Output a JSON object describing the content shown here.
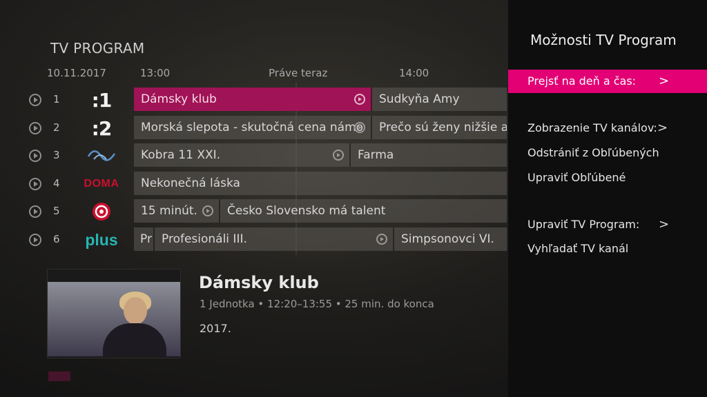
{
  "epg": {
    "title": "TV PROGRAM",
    "date": "10.11.2017",
    "times": [
      "13:00",
      "Práve teraz",
      "14:00"
    ],
    "channels": [
      {
        "number": "1",
        "logo_text": ":1",
        "programs": [
          {
            "title": "Dámsky klub",
            "selected": true,
            "replay": true
          },
          {
            "title": "Sudkyňa Amy",
            "selected": false,
            "replay": false
          }
        ]
      },
      {
        "number": "2",
        "logo_text": ":2",
        "programs": [
          {
            "title": "Morská slepota - skutočná cena námo",
            "selected": false,
            "replay": true
          },
          {
            "title": "Prečo sú ženy nižšie ak",
            "selected": false,
            "replay": false
          }
        ]
      },
      {
        "number": "3",
        "logo_text": "",
        "programs": [
          {
            "title": "Kobra 11 XXI.",
            "selected": false,
            "replay": true
          },
          {
            "title": "Farma",
            "selected": false,
            "replay": false
          }
        ]
      },
      {
        "number": "4",
        "logo_text": "DOMA",
        "programs": [
          {
            "title": "Nekonečná láska",
            "selected": false,
            "replay": false
          }
        ]
      },
      {
        "number": "5",
        "logo_text": "",
        "programs": [
          {
            "title": "15 minút.",
            "selected": false,
            "replay": true
          },
          {
            "title": "Česko Slovensko má talent",
            "selected": false,
            "replay": false
          }
        ]
      },
      {
        "number": "6",
        "logo_text": "plus",
        "programs": [
          {
            "title": "Pr",
            "selected": false,
            "replay": false
          },
          {
            "title": "Profesionáli III.",
            "selected": false,
            "replay": true
          },
          {
            "title": "Simpsonovci VI.",
            "selected": false,
            "replay": false
          }
        ]
      }
    ]
  },
  "info": {
    "title": "Dámsky klub",
    "meta": "1 Jednotka • 12:20–13:55 • 25 min. do konca",
    "description": "2017."
  },
  "panel": {
    "title": "Možnosti TV Program",
    "items": [
      {
        "label": "Prejsť na deň a čas:",
        "has_submenu": true,
        "selected": true
      },
      {
        "label": "Zobrazenie TV kanálov:",
        "has_submenu": true,
        "selected": false
      },
      {
        "label": "Odstrániť z Obľúbených",
        "has_submenu": false,
        "selected": false
      },
      {
        "label": "Upraviť Obľúbené",
        "has_submenu": false,
        "selected": false
      },
      {
        "label": "Upraviť TV Program:",
        "has_submenu": true,
        "selected": false
      },
      {
        "label": "Vyhľadať TV kanál",
        "has_submenu": false,
        "selected": false
      }
    ],
    "chevron": ">"
  },
  "colors": {
    "accent": "#e20074",
    "selected_program": "#a01356"
  }
}
